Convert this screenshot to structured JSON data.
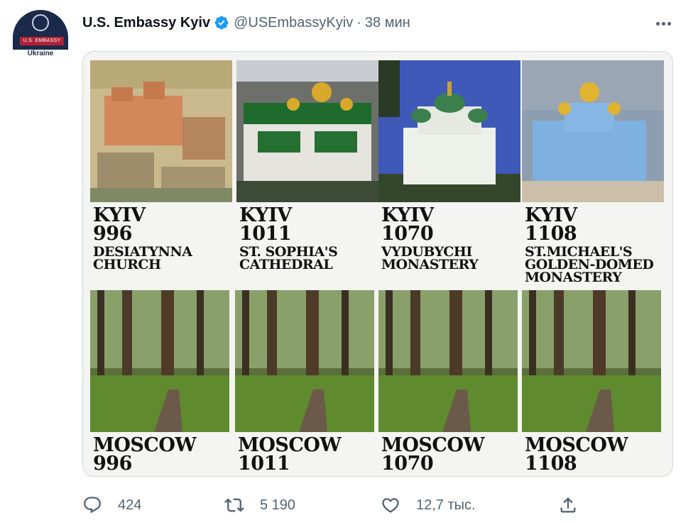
{
  "account": {
    "avatar_banner": "U.S. EMBASSY",
    "avatar_subtitle": "Ukraine",
    "display_name": "U.S. Embassy Kyiv",
    "handle": "@USEmbassyKyiv",
    "separator": "·",
    "time": "38 мин",
    "verified": true
  },
  "image": {
    "top_row": [
      {
        "city": "KYIV",
        "year": "996",
        "place_lines": [
          "DESIATYNNA",
          "CHURCH"
        ]
      },
      {
        "city": "KYIV",
        "year": "1011",
        "place_lines": [
          "ST. SOPHIA'S",
          "CATHEDRAL"
        ]
      },
      {
        "city": "KYIV",
        "year": "1070",
        "place_lines": [
          "VYDUBYCHI",
          "MONASTERY"
        ]
      },
      {
        "city": "KYIV",
        "year": "1108",
        "place_lines": [
          "ST.MICHAEL'S",
          "GOLDEN-DOMED",
          "MONASTERY"
        ]
      }
    ],
    "bottom_row": [
      {
        "city": "MOSCOW",
        "year": "996"
      },
      {
        "city": "MOSCOW",
        "year": "1011"
      },
      {
        "city": "MOSCOW",
        "year": "1070"
      },
      {
        "city": "MOSCOW",
        "year": "1108"
      }
    ]
  },
  "actions": {
    "reply_count": "424",
    "retweet_count": "5 190",
    "like_count": "12,7 тыс.",
    "icons": [
      "reply-icon",
      "retweet-icon",
      "like-icon",
      "share-icon"
    ]
  },
  "colors": {
    "verified": "#1d9bf0",
    "secondary_text": "#536471",
    "border": "#cfd9de"
  }
}
